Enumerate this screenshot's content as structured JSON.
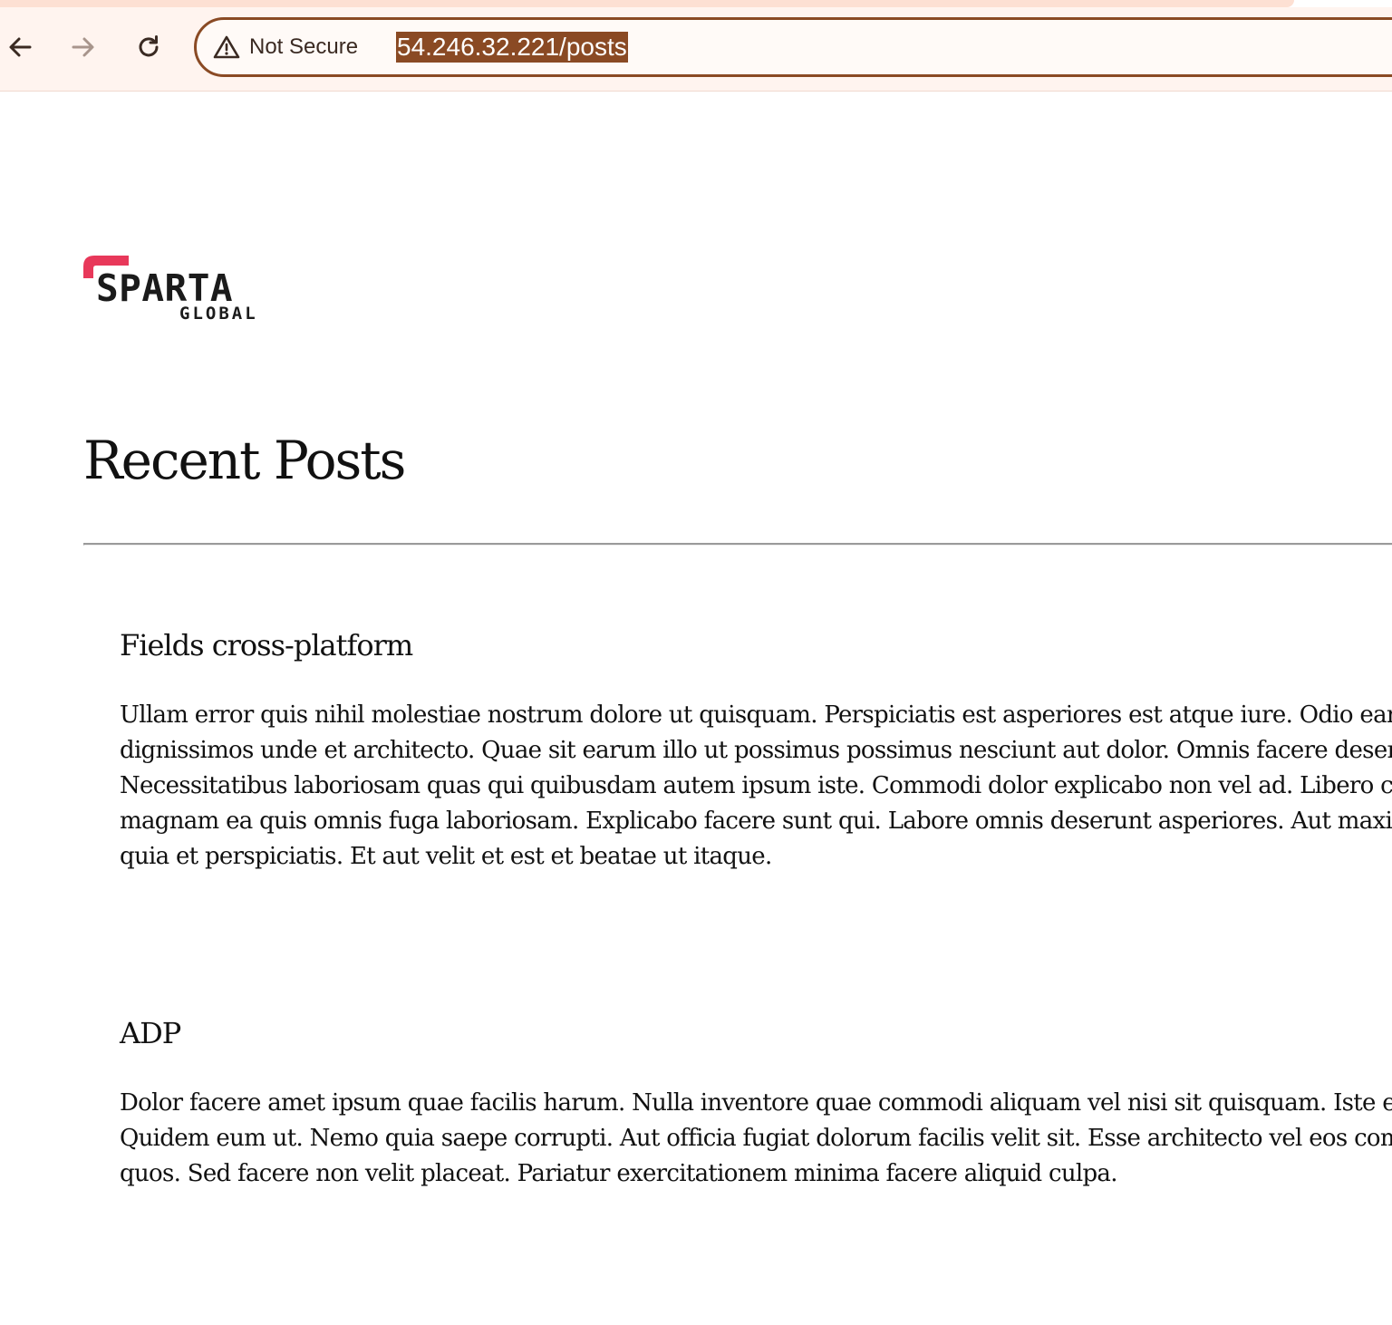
{
  "browser": {
    "security_label": "Not Secure",
    "url": "54.246.32.221/posts",
    "icons": {
      "back": "arrow-left",
      "forward": "arrow-right",
      "reload": "reload",
      "security": "warning-triangle"
    },
    "accent_color": "#8a4a24"
  },
  "site": {
    "logo_text": "SPARTA",
    "logo_subtext": "GLOBAL",
    "logo_accent_color": "#e8385a"
  },
  "page": {
    "title": "Recent Posts"
  },
  "posts": [
    {
      "title": "Fields cross-platform",
      "body_lines": [
        "Ullam error quis nihil molestiae nostrum dolore ut quisquam. Perspiciatis est asperiores est atque iure. Odio earu",
        "dignissimos unde et architecto. Quae sit earum illo ut possimus possimus nesciunt aut dolor. Omnis facere deser",
        "Necessitatibus laboriosam quas qui quibusdam autem ipsum iste. Commodi dolor explicabo non vel ad. Libero c",
        "magnam ea quis omnis fuga laboriosam. Explicabo facere sunt qui. Labore omnis deserunt asperiores. Aut maxir",
        "quia et perspiciatis. Et aut velit et est et beatae ut itaque."
      ]
    },
    {
      "title": "ADP",
      "body_lines": [
        "Dolor facere amet ipsum quae facilis harum. Nulla inventore quae commodi aliquam vel nisi sit quisquam. Iste e",
        "Quidem eum ut. Nemo quia saepe corrupti. Aut officia fugiat dolorum facilis velit sit. Esse architecto vel eos com",
        "quos. Sed facere non velit placeat. Pariatur exercitationem minima facere aliquid culpa."
      ]
    }
  ]
}
